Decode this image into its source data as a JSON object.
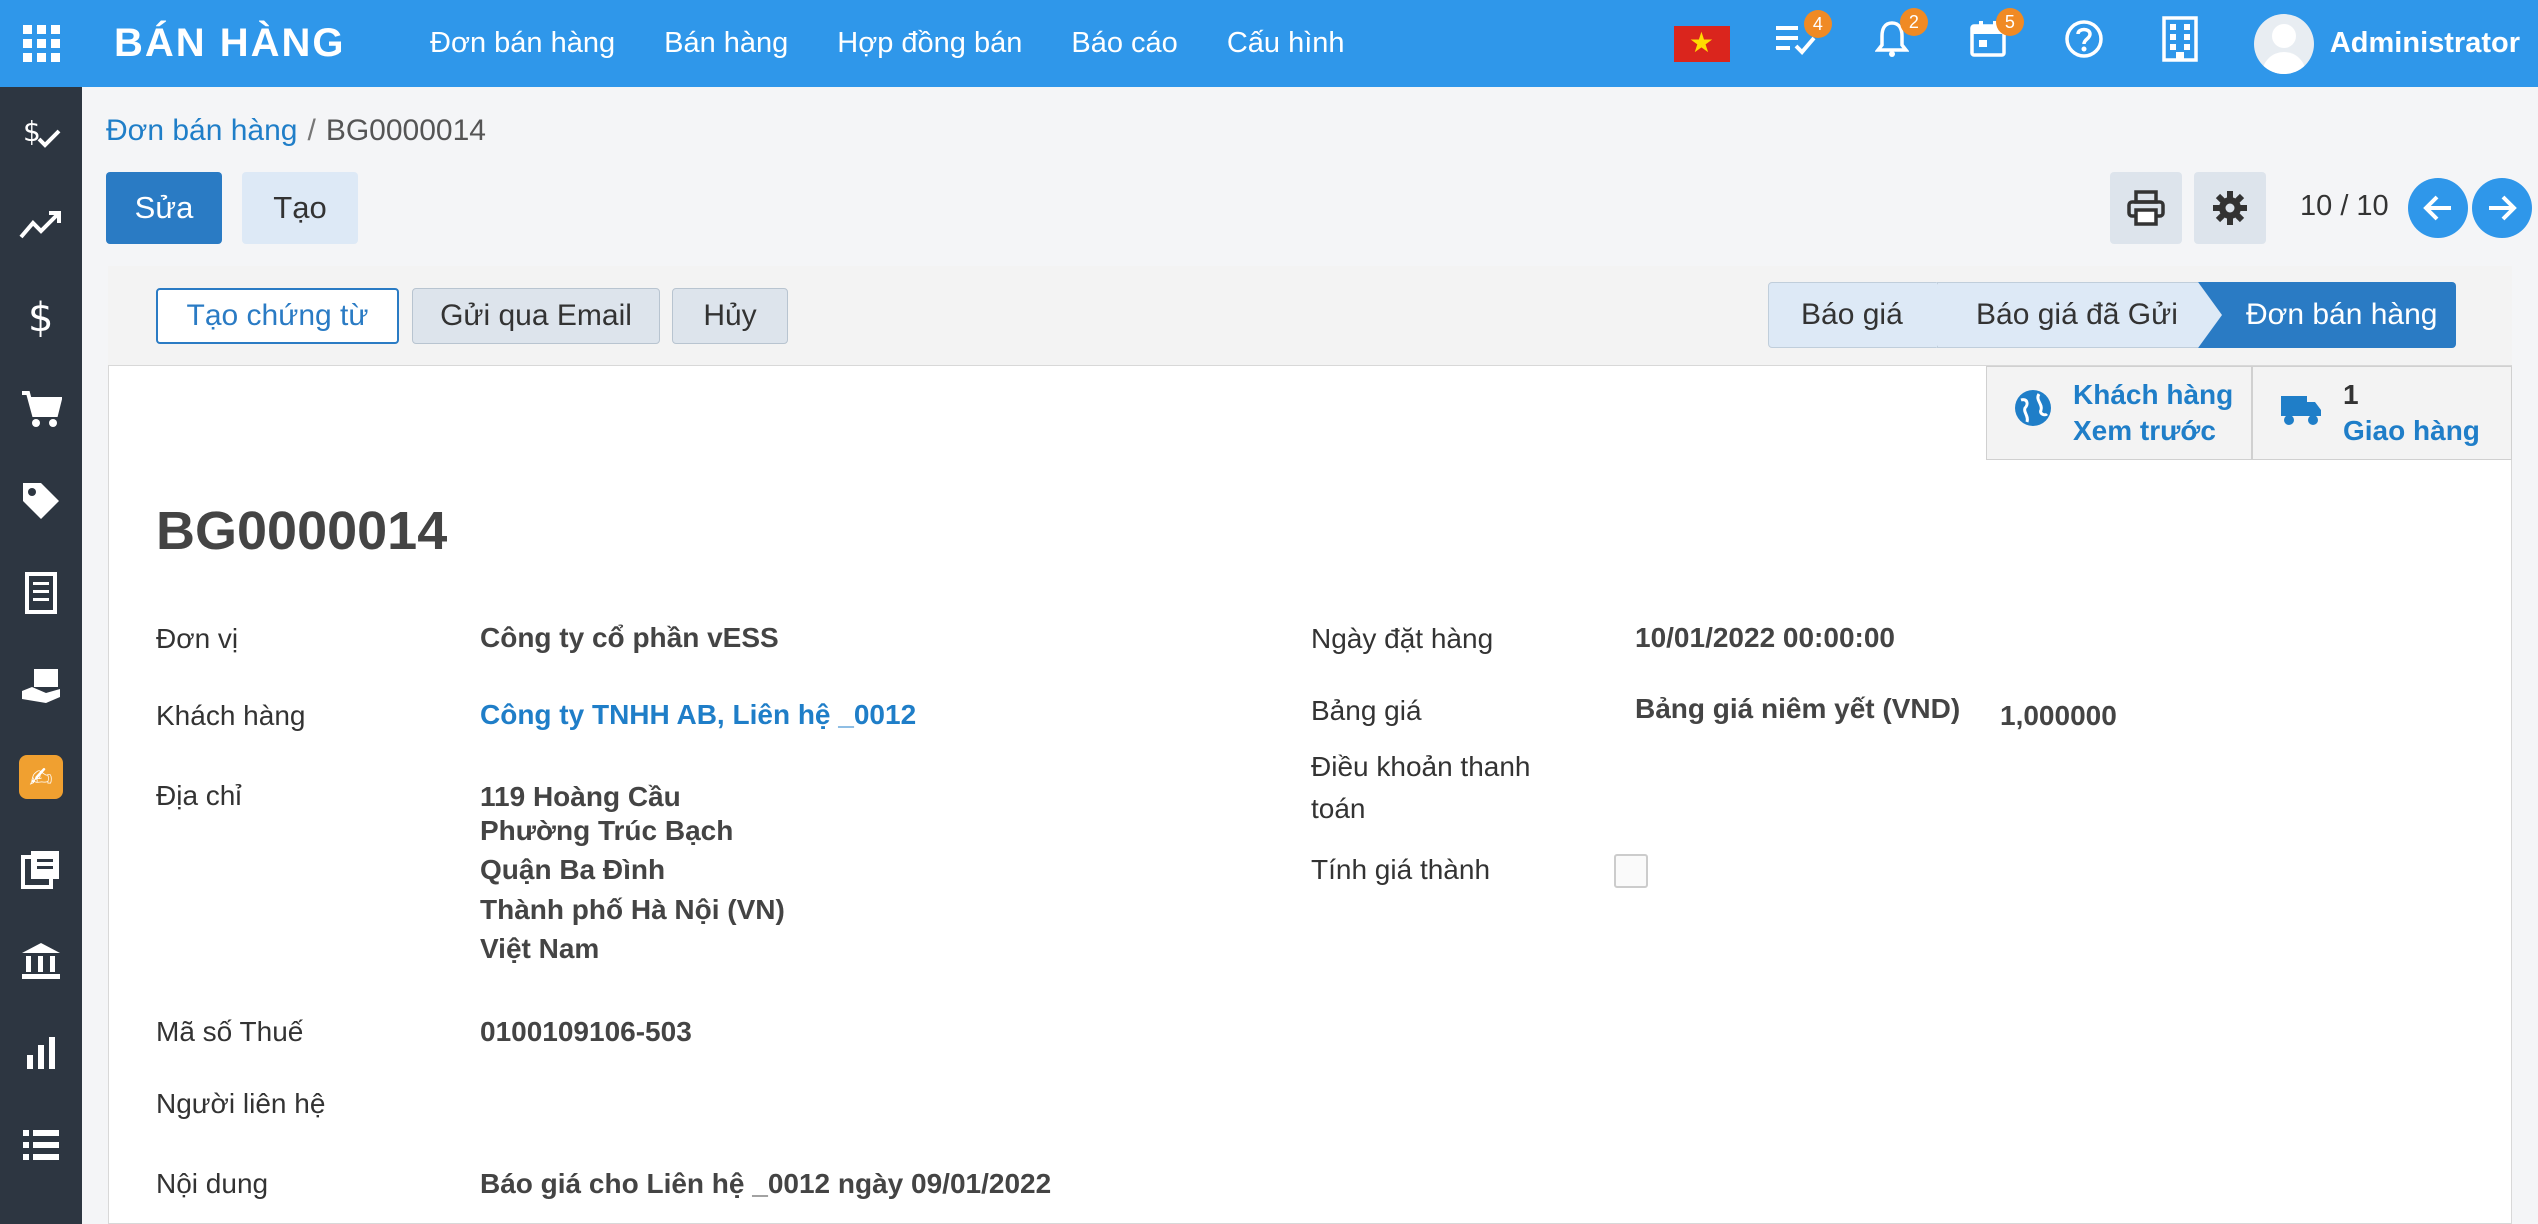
{
  "topbar": {
    "app_title": "BÁN HÀNG",
    "menu": [
      "Đơn bán hàng",
      "Bán hàng",
      "Hợp đồng bán",
      "Báo cáo",
      "Cấu hình"
    ],
    "activity_count": "4",
    "notification_count": "2",
    "calendar_count": "5",
    "user_name": "Administrator"
  },
  "control": {
    "breadcrumb_parent": "Đơn bán hàng",
    "breadcrumb_sep": "/",
    "breadcrumb_current": "BG0000014",
    "edit_label": "Sửa",
    "create_label": "Tạo",
    "pager": "10 / 10"
  },
  "statusbar": {
    "create_doc": "Tạo chứng từ",
    "send_email": "Gửi qua Email",
    "cancel": "Hủy",
    "stages": [
      "Báo giá",
      "Báo giá đã Gửi",
      "Đơn bán hàng"
    ],
    "active_stage": "Đơn bán hàng"
  },
  "smart_buttons": {
    "customer_line1": "Khách hàng",
    "customer_line2": "Xem trước",
    "delivery_count": "1",
    "delivery_label": "Giao hàng"
  },
  "record": {
    "title": "BG0000014",
    "left": {
      "unit_label": "Đơn vị",
      "unit_value": "Công ty cổ phần vESS",
      "customer_label": "Khách hàng",
      "customer_value": "Công ty TNHH AB, Liên hệ _0012",
      "address_label": "Địa chỉ",
      "address_lines": [
        "119 Hoàng Cầu",
        "Phường Trúc Bạch",
        "Quận Ba Đình",
        "Thành phố Hà Nội (VN)",
        "Việt Nam"
      ],
      "tax_label": "Mã số Thuế",
      "tax_value": "0100109106-503",
      "contact_label": "Người liên hệ",
      "content_label": "Nội dung",
      "content_value": "Báo giá cho Liên hệ _0012 ngày 09/01/2022"
    },
    "right": {
      "order_date_label": "Ngày đặt hàng",
      "order_date_value": "10/01/2022 00:00:00",
      "pricelist_label": "Bảng giá",
      "pricelist_value": "Bảng giá niêm yết (VND)",
      "rate_value": "1,000000",
      "payment_terms_label": "Điều khoản thanh toán",
      "costing_label": "Tính giá thành"
    }
  },
  "sidebar_icons": [
    "checklist-dollar-icon",
    "trend-icon",
    "dollar-icon",
    "cart-icon",
    "tag-icon",
    "receipt-icon",
    "hand-money-icon",
    "sign-icon",
    "book-icon",
    "bank-icon",
    "bar-chart-icon",
    "list-icon"
  ]
}
